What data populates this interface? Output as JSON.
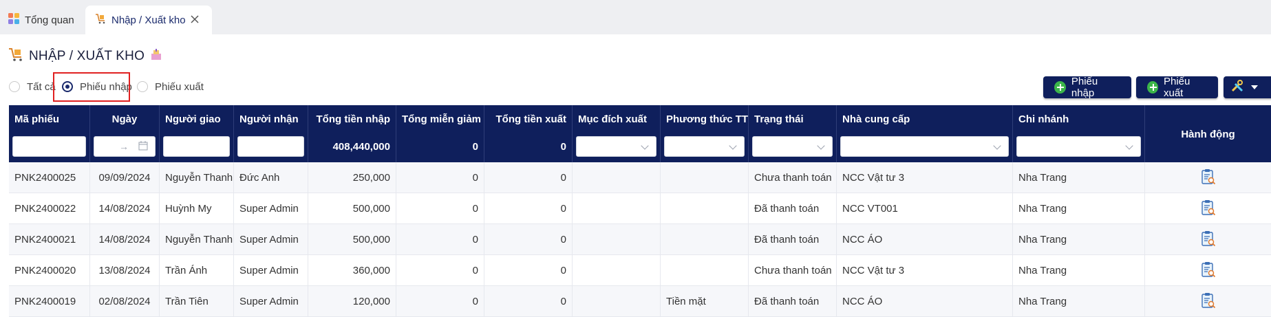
{
  "tabs": [
    {
      "label": "Tổng quan"
    },
    {
      "label": "Nhập / Xuất kho"
    }
  ],
  "page": {
    "title": "NHẬP / XUẤT KHO"
  },
  "filters": {
    "radios": [
      {
        "label": "Tất cả",
        "checked": false
      },
      {
        "label": "Phiếu nhập",
        "checked": true
      },
      {
        "label": "Phiếu xuất",
        "checked": false
      }
    ]
  },
  "actions": {
    "import_label": "Phiếu nhập",
    "export_label": "Phiếu xuất"
  },
  "table": {
    "columns": [
      "Mã phiếu",
      "Ngày",
      "Người giao",
      "Người nhận",
      "Tổng tiền nhập",
      "Tổng miễn giảm",
      "Tổng tiền xuất",
      "Mục đích xuất",
      "Phương thức TT",
      "Trạng thái",
      "Nhà cung cấp",
      "Chi nhánh",
      "Hành động"
    ],
    "totals": {
      "import": "408,440,000",
      "discount": "0",
      "export": "0"
    },
    "date_separator": "→",
    "rows": [
      {
        "code": "PNK2400025",
        "date": "09/09/2024",
        "deliverer": "Nguyễn Thanh",
        "receiver": "Đức Anh",
        "import": "250,000",
        "discount": "0",
        "export": "0",
        "purpose": "",
        "payment": "",
        "status": "Chưa thanh toán",
        "supplier": "NCC Vật tư 3",
        "branch": "Nha Trang"
      },
      {
        "code": "PNK2400022",
        "date": "14/08/2024",
        "deliverer": "Huỳnh My",
        "receiver": "Super Admin",
        "import": "500,000",
        "discount": "0",
        "export": "0",
        "purpose": "",
        "payment": "",
        "status": "Đã thanh toán",
        "supplier": "NCC VT001",
        "branch": "Nha Trang"
      },
      {
        "code": "PNK2400021",
        "date": "14/08/2024",
        "deliverer": "Nguyễn Thanh",
        "receiver": "Super Admin",
        "import": "500,000",
        "discount": "0",
        "export": "0",
        "purpose": "",
        "payment": "",
        "status": "Đã thanh toán",
        "supplier": "NCC ÁO",
        "branch": "Nha Trang"
      },
      {
        "code": "PNK2400020",
        "date": "13/08/2024",
        "deliverer": "Trần Ánh",
        "receiver": "Super Admin",
        "import": "360,000",
        "discount": "0",
        "export": "0",
        "purpose": "",
        "payment": "",
        "status": "Chưa thanh toán",
        "supplier": "NCC Vật tư 3",
        "branch": "Nha Trang"
      },
      {
        "code": "PNK2400019",
        "date": "02/08/2024",
        "deliverer": "Trần Tiên",
        "receiver": "Super Admin",
        "import": "120,000",
        "discount": "0",
        "export": "0",
        "purpose": "",
        "payment": "Tiền mặt",
        "status": "Đã thanh toán",
        "supplier": "NCC ÁO",
        "branch": "Nha Trang"
      }
    ]
  },
  "colors": {
    "primary": "#0f1f5c",
    "accent_green": "#3cb54a",
    "highlight_red": "#e02020"
  }
}
